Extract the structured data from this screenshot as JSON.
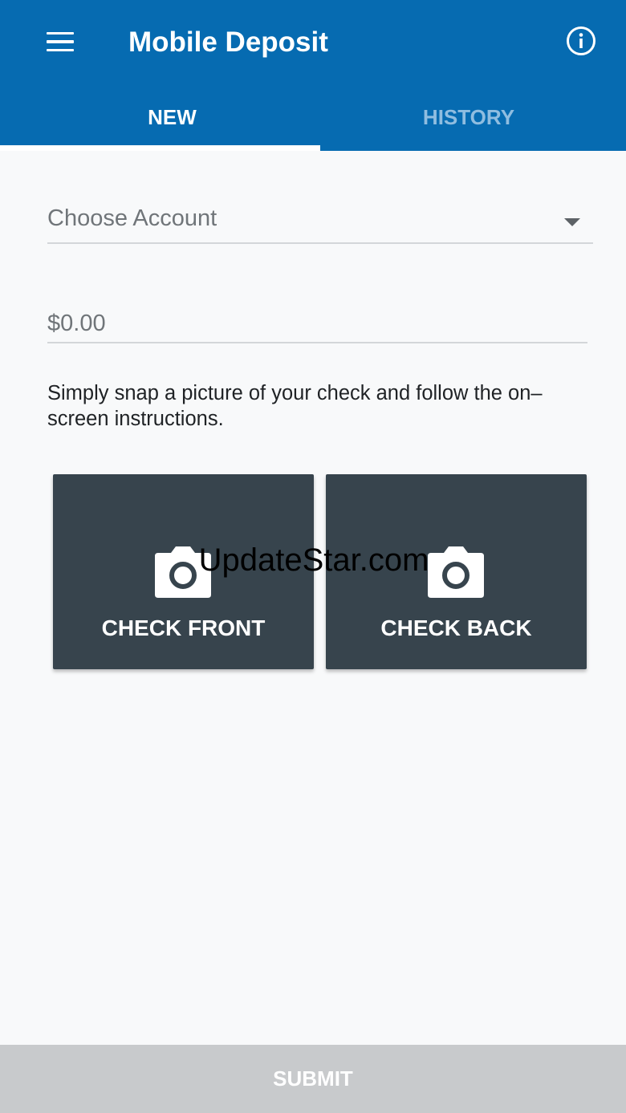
{
  "header": {
    "title": "Mobile Deposit",
    "menu_icon": "hamburger-menu-icon",
    "info_icon": "info-icon"
  },
  "tabs": [
    {
      "label": "NEW",
      "active": true
    },
    {
      "label": "HISTORY",
      "active": false
    }
  ],
  "form": {
    "account_placeholder": "Choose Account",
    "amount_placeholder": "$0.00",
    "instructions": "Simply snap a picture of your check and follow the on–screen instructions."
  },
  "capture_buttons": [
    {
      "label": "CHECK FRONT",
      "icon": "camera-icon"
    },
    {
      "label": "CHECK BACK",
      "icon": "camera-icon"
    }
  ],
  "watermark": "UpdateStar.com",
  "footer": {
    "submit_label": "SUBMIT"
  },
  "colors": {
    "appbar": "#066bb1",
    "tab_inactive": "#8fbde0",
    "capture_button": "#37444d",
    "submit_disabled": "#c8cacc",
    "background": "#f8f9fa"
  }
}
